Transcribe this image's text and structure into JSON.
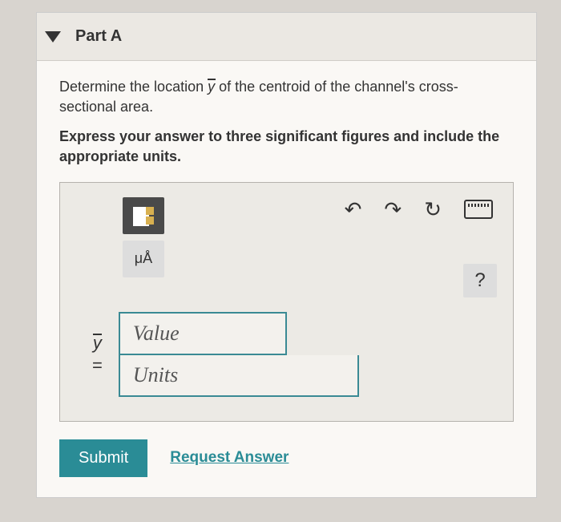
{
  "part": {
    "title": "Part A",
    "prompt_before_var": "Determine the location ",
    "prompt_var": "y",
    "prompt_after_var": " of the centroid of the channel's cross-sectional area.",
    "instruction": "Express your answer to three significant figures and include the appropriate units."
  },
  "toolbar": {
    "units_symbol_label": "μÅ",
    "help_label": "?"
  },
  "answer": {
    "variable": "y",
    "equals": "=",
    "value_placeholder": "Value",
    "units_placeholder": "Units"
  },
  "actions": {
    "submit": "Submit",
    "request": "Request Answer"
  }
}
